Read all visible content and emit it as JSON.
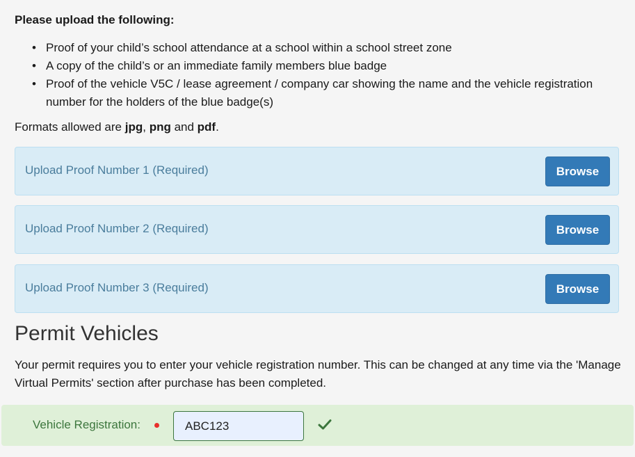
{
  "uploads": {
    "heading": "Please upload the following:",
    "bullet": "•",
    "requirements": [
      "Proof of your child’s school attendance at a school within a school street zone",
      "A copy of the child’s or an immediate family members blue badge",
      "Proof of the vehicle V5C / lease agreement / company car showing the name and the vehicle registration number for the holders of the blue badge(s)"
    ],
    "formats_prefix": "Formats allowed are ",
    "format_1": "jpg",
    "sep_1": ", ",
    "format_2": "png",
    "sep_2": " and ",
    "format_3": "pdf",
    "formats_suffix": ".",
    "panels": [
      {
        "label": "Upload Proof Number 1 (Required)",
        "button": "Browse"
      },
      {
        "label": "Upload Proof Number 2 (Required)",
        "button": "Browse"
      },
      {
        "label": "Upload Proof Number 3 (Required)",
        "button": "Browse"
      }
    ]
  },
  "permit": {
    "title": "Permit Vehicles",
    "description": "Your permit requires you to enter your vehicle registration number. This can be changed at any time via the 'Manage Virtual Permits' section after purchase has been completed.",
    "vehicle_label": "Vehicle Registration:",
    "vehicle_value": "ABC123",
    "valid_icon": "checkmark-icon"
  },
  "colors": {
    "panel_bg": "#d9ecf6",
    "button_bg": "#337ab7",
    "success_bg": "#dff0d8",
    "success_text": "#3c763d",
    "required_dot": "#e8302c"
  }
}
